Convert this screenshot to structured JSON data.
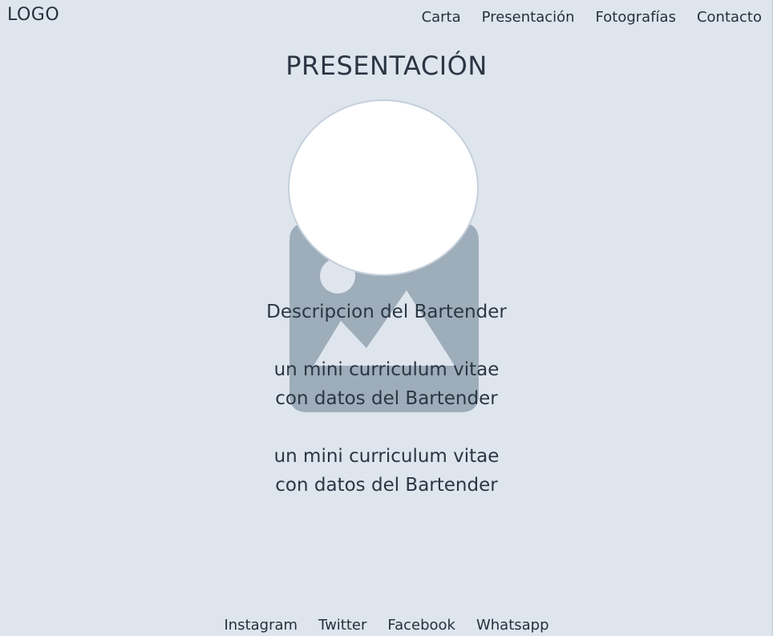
{
  "header": {
    "logo": "LOGO",
    "nav": [
      {
        "label": "Carta"
      },
      {
        "label": "Presentación"
      },
      {
        "label": "Fotografías"
      },
      {
        "label": "Contacto"
      }
    ]
  },
  "main": {
    "title": "PRESENTACIÓN",
    "image_icon": "image-placeholder-icon",
    "description": "Descripcion del Bartender",
    "cv_blocks": [
      {
        "line1": "un mini curriculum vitae",
        "line2": "con datos del Bartender"
      },
      {
        "line1": "un mini curriculum vitae",
        "line2": "con datos del Bartender"
      }
    ]
  },
  "footer": {
    "links": [
      {
        "label": "Instagram"
      },
      {
        "label": "Twitter"
      },
      {
        "label": "Facebook"
      },
      {
        "label": "Whatsapp"
      }
    ]
  },
  "colors": {
    "background": "#dfe5ed",
    "text": "#25313d",
    "placeholder": "#9eadba",
    "avatar": "#ffffff"
  }
}
